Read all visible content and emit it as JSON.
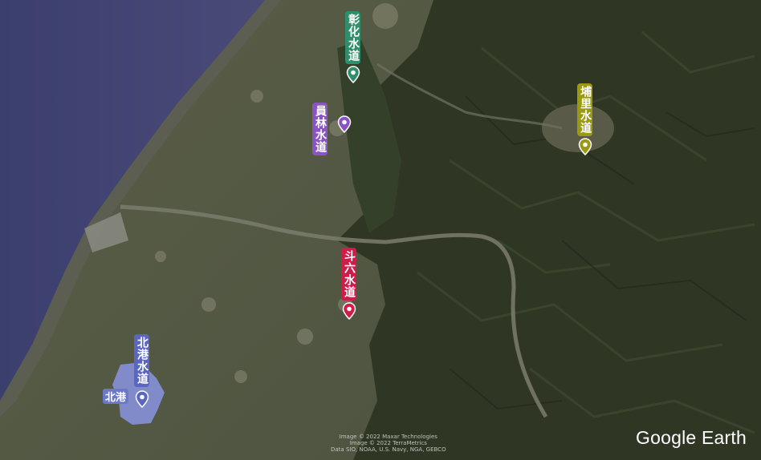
{
  "markers": [
    {
      "id": "changhua",
      "label": "彰化水道",
      "color": "#2f8f6a"
    },
    {
      "id": "yuanlin",
      "label": "員林水道",
      "color": "#8a54c4"
    },
    {
      "id": "puli",
      "label": "埔里水道",
      "color": "#9a9a12"
    },
    {
      "id": "douliu",
      "label": "斗六水道",
      "color": "#d01c48"
    },
    {
      "id": "beigang",
      "label": "北港水道",
      "color": "#5a66c0"
    }
  ],
  "area": {
    "label": "北港",
    "color": "#8a94e0"
  },
  "attribution": {
    "line1": "Image © 2022 Maxar Technologies",
    "line2": "Image © 2022 TerraMetrics",
    "line3": "Data SIO, NOAA, U.S. Navy, NGA, GEBCO"
  },
  "brand": "Google Earth"
}
